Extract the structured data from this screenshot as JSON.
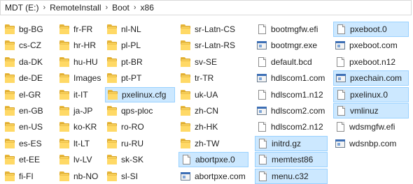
{
  "breadcrumb": {
    "segments": [
      "MDT (E:)",
      "RemoteInstall",
      "Boot",
      "x86"
    ],
    "separator": "›"
  },
  "icons": {
    "folder": "folder-icon",
    "file": "file-icon",
    "app": "application-icon"
  },
  "colors": {
    "selection_bg": "#cce8ff",
    "selection_border": "#99d1ff",
    "folder": "#ffd966"
  },
  "columns": [
    [
      {
        "label": "bg-BG",
        "type": "folder",
        "selected": false
      },
      {
        "label": "cs-CZ",
        "type": "folder",
        "selected": false
      },
      {
        "label": "da-DK",
        "type": "folder",
        "selected": false
      },
      {
        "label": "de-DE",
        "type": "folder",
        "selected": false
      },
      {
        "label": "el-GR",
        "type": "folder",
        "selected": false
      },
      {
        "label": "en-GB",
        "type": "folder",
        "selected": false
      },
      {
        "label": "en-US",
        "type": "folder",
        "selected": false
      },
      {
        "label": "es-ES",
        "type": "folder",
        "selected": false
      },
      {
        "label": "et-EE",
        "type": "folder",
        "selected": false
      },
      {
        "label": "fi-FI",
        "type": "folder",
        "selected": false
      }
    ],
    [
      {
        "label": "fr-FR",
        "type": "folder",
        "selected": false
      },
      {
        "label": "hr-HR",
        "type": "folder",
        "selected": false
      },
      {
        "label": "hu-HU",
        "type": "folder",
        "selected": false
      },
      {
        "label": "Images",
        "type": "folder",
        "selected": false
      },
      {
        "label": "it-IT",
        "type": "folder",
        "selected": false
      },
      {
        "label": "ja-JP",
        "type": "folder",
        "selected": false
      },
      {
        "label": "ko-KR",
        "type": "folder",
        "selected": false
      },
      {
        "label": "lt-LT",
        "type": "folder",
        "selected": false
      },
      {
        "label": "lv-LV",
        "type": "folder",
        "selected": false
      },
      {
        "label": "nb-NO",
        "type": "folder",
        "selected": false
      }
    ],
    [
      {
        "label": "nl-NL",
        "type": "folder",
        "selected": false
      },
      {
        "label": "pl-PL",
        "type": "folder",
        "selected": false
      },
      {
        "label": "pt-BR",
        "type": "folder",
        "selected": false
      },
      {
        "label": "pt-PT",
        "type": "folder",
        "selected": false
      },
      {
        "label": "pxelinux.cfg",
        "type": "folder",
        "selected": true
      },
      {
        "label": "qps-ploc",
        "type": "folder",
        "selected": false
      },
      {
        "label": "ro-RO",
        "type": "folder",
        "selected": false
      },
      {
        "label": "ru-RU",
        "type": "folder",
        "selected": false
      },
      {
        "label": "sk-SK",
        "type": "folder",
        "selected": false
      },
      {
        "label": "sl-SI",
        "type": "folder",
        "selected": false
      }
    ],
    [
      {
        "label": "sr-Latn-CS",
        "type": "folder",
        "selected": false
      },
      {
        "label": "sr-Latn-RS",
        "type": "folder",
        "selected": false
      },
      {
        "label": "sv-SE",
        "type": "folder",
        "selected": false
      },
      {
        "label": "tr-TR",
        "type": "folder",
        "selected": false
      },
      {
        "label": "uk-UA",
        "type": "folder",
        "selected": false
      },
      {
        "label": "zh-CN",
        "type": "folder",
        "selected": false
      },
      {
        "label": "zh-HK",
        "type": "folder",
        "selected": false
      },
      {
        "label": "zh-TW",
        "type": "folder",
        "selected": false
      },
      {
        "label": "abortpxe.0",
        "type": "file",
        "selected": true
      },
      {
        "label": "abortpxe.com",
        "type": "app",
        "selected": false
      }
    ],
    [
      {
        "label": "bootmgfw.efi",
        "type": "file",
        "selected": false
      },
      {
        "label": "bootmgr.exe",
        "type": "app",
        "selected": false
      },
      {
        "label": "default.bcd",
        "type": "file",
        "selected": false
      },
      {
        "label": "hdlscom1.com",
        "type": "app",
        "selected": false
      },
      {
        "label": "hdlscom1.n12",
        "type": "file",
        "selected": false
      },
      {
        "label": "hdlscom2.com",
        "type": "app",
        "selected": false
      },
      {
        "label": "hdlscom2.n12",
        "type": "file",
        "selected": false
      },
      {
        "label": "initrd.gz",
        "type": "file",
        "selected": true
      },
      {
        "label": "memtest86",
        "type": "file",
        "selected": true
      },
      {
        "label": "menu.c32",
        "type": "file",
        "selected": true
      }
    ],
    [
      {
        "label": "pxeboot.0",
        "type": "file",
        "selected": true
      },
      {
        "label": "pxeboot.com",
        "type": "app",
        "selected": false
      },
      {
        "label": "pxeboot.n12",
        "type": "file",
        "selected": false
      },
      {
        "label": "pxechain.com",
        "type": "app",
        "selected": true
      },
      {
        "label": "pxelinux.0",
        "type": "file",
        "selected": true
      },
      {
        "label": "vmlinuz",
        "type": "file",
        "selected": true
      },
      {
        "label": "wdsmgfw.efi",
        "type": "file",
        "selected": false
      },
      {
        "label": "wdsnbp.com",
        "type": "app",
        "selected": false
      }
    ]
  ]
}
